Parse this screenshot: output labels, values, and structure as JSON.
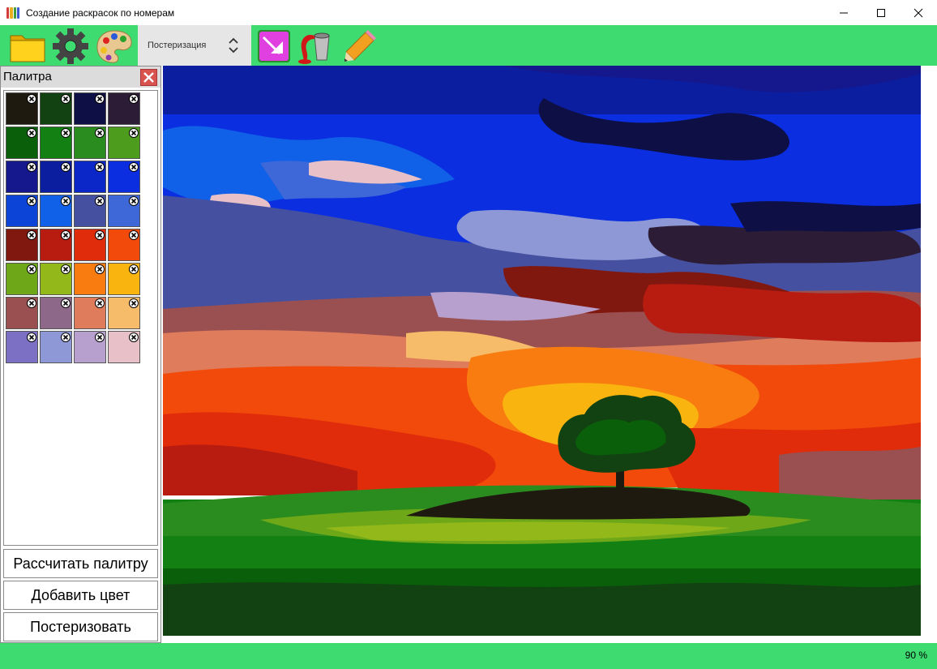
{
  "window": {
    "title": "Создание раскрасок по номерам"
  },
  "toolbar": {
    "mode_select": {
      "value": "Постеризация"
    },
    "icons": [
      "folder-icon",
      "gear-icon",
      "palette-icon",
      "pointer-tool-icon",
      "paint-bucket-icon",
      "pencil-icon"
    ]
  },
  "palette": {
    "title": "Палитра",
    "colors": [
      "#1f1a10",
      "#124212",
      "#0e0f45",
      "#2c1c36",
      "#0a5f0a",
      "#128012",
      "#2a8c1f",
      "#4e9c1e",
      "#14188c",
      "#0c1ea0",
      "#0b27c8",
      "#0a2ee0",
      "#0c44d8",
      "#1060e8",
      "#4650a0",
      "#3e68d8",
      "#801810",
      "#b81c10",
      "#e02c0a",
      "#f24a0a",
      "#6ea818",
      "#92b81a",
      "#f87c10",
      "#fab410",
      "#9a5050",
      "#8e6888",
      "#de7c5c",
      "#f6bc6a",
      "#7c70c4",
      "#8e98d6",
      "#b8a0ce",
      "#e8c0c8"
    ],
    "buttons": {
      "calculate": "Рассчитать палитру",
      "add_color": "Добавить цвет",
      "posterize": "Постеризовать"
    }
  },
  "status": {
    "zoom": "90 %"
  },
  "theme": {
    "accent": "#3ddb70"
  }
}
